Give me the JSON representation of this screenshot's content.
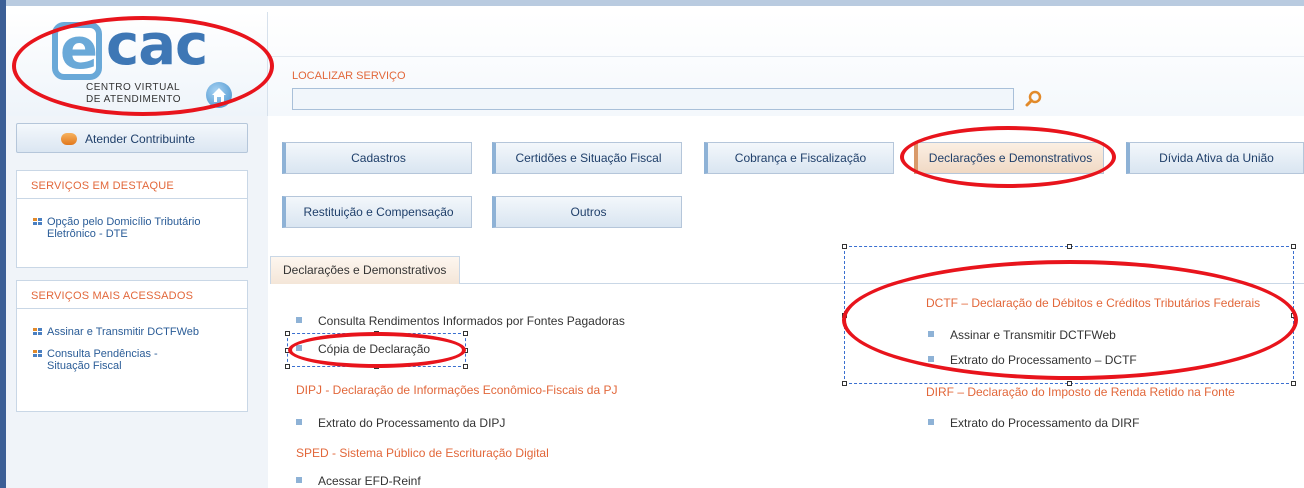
{
  "header": {
    "logo_text": "cac",
    "logo_line1": "CENTRO VIRTUAL",
    "logo_line2": "DE ATENDIMENTO",
    "search_label": "LOCALIZAR SERVIÇO",
    "search_value": ""
  },
  "sidebar": {
    "atender_label": "Atender Contribuinte",
    "destaque_title": "SERVIÇOS EM DESTAQUE",
    "destaque_items": [
      "Opção pelo Domicílio Tributário Eletrônico - DTE"
    ],
    "acessados_title": "SERVIÇOS MAIS ACESSADOS",
    "acessados_items": [
      "Assinar e Transmitir DCTFWeb",
      "Consulta Pendências - Situação Fiscal"
    ]
  },
  "tabs": {
    "cadastros": "Cadastros",
    "certidoes": "Certidões e Situação Fiscal",
    "cobranca": "Cobrança e Fiscalização",
    "declaracoes": "Declarações e Demonstrativos",
    "divida": "Dívida Ativa da União",
    "restituicao": "Restituição e Compensação",
    "outros": "Outros"
  },
  "panel": {
    "title": "Declarações e Demonstrativos",
    "left": {
      "item_consulta": "Consulta Rendimentos Informados por Fontes Pagadoras",
      "item_copia": "Cópia de Declaração",
      "section_dipj": "DIPJ - Declaração de Informações Econômico-Fiscais da PJ",
      "item_dipj": "Extrato do Processamento da DIPJ",
      "section_sped": "SPED - Sistema Público de Escrituração Digital",
      "item_reinf": "Acessar EFD-Reinf"
    },
    "right": {
      "section_dctf": "DCTF – Declaração de Débitos e Créditos Tributários Federais",
      "item_dctfweb": "Assinar e Transmitir DCTFWeb",
      "item_extrato_dctf": "Extrato do Processamento – DCTF",
      "section_dirf": "DIRF – Declaração do Imposto de Renda Retido na Fonte",
      "item_dirf": "Extrato do Processamento da DIRF"
    }
  },
  "colors": {
    "accent_orange": "#e2673a",
    "link_blue": "#2a5c97",
    "annotation_red": "#e8141c"
  }
}
